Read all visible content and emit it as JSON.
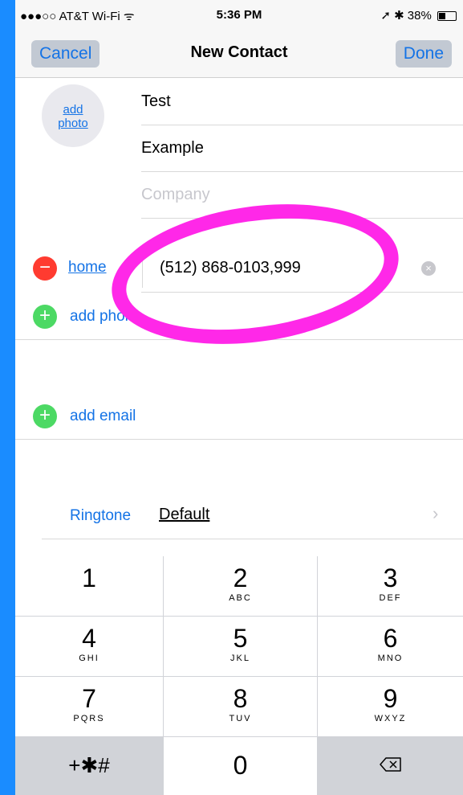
{
  "status_bar": {
    "carrier": "●●●○○ AT&T Wi-Fi ᯤ",
    "time": "5:36 PM",
    "right": "➚ ✱ 38%"
  },
  "nav": {
    "cancel": "Cancel",
    "title": "New Contact",
    "done": "Done"
  },
  "avatar": {
    "label": "add photo"
  },
  "fields": {
    "first_name": "Test",
    "last_name": "Example",
    "company_placeholder": "Company"
  },
  "phone": {
    "label": "home",
    "number": "(512) 868-0103,999",
    "add_phone": "add phone"
  },
  "email": {
    "add_email": "add email"
  },
  "ringtone": {
    "label": "Ringtone",
    "value": "Default"
  },
  "keypad": {
    "keys": [
      {
        "digit": "1",
        "letters": ""
      },
      {
        "digit": "2",
        "letters": "ABC"
      },
      {
        "digit": "3",
        "letters": "DEF"
      },
      {
        "digit": "4",
        "letters": "GHI"
      },
      {
        "digit": "5",
        "letters": "JKL"
      },
      {
        "digit": "6",
        "letters": "MNO"
      },
      {
        "digit": "7",
        "letters": "PQRS"
      },
      {
        "digit": "8",
        "letters": "TUV"
      },
      {
        "digit": "9",
        "letters": "WXYZ"
      },
      {
        "digit": "+✱#",
        "letters": ""
      },
      {
        "digit": "0",
        "letters": ""
      },
      {
        "digit": "",
        "letters": ""
      }
    ]
  },
  "colors": {
    "accent": "#1473e6",
    "annotation": "#ff28e8",
    "frame": "#1a8cff"
  }
}
